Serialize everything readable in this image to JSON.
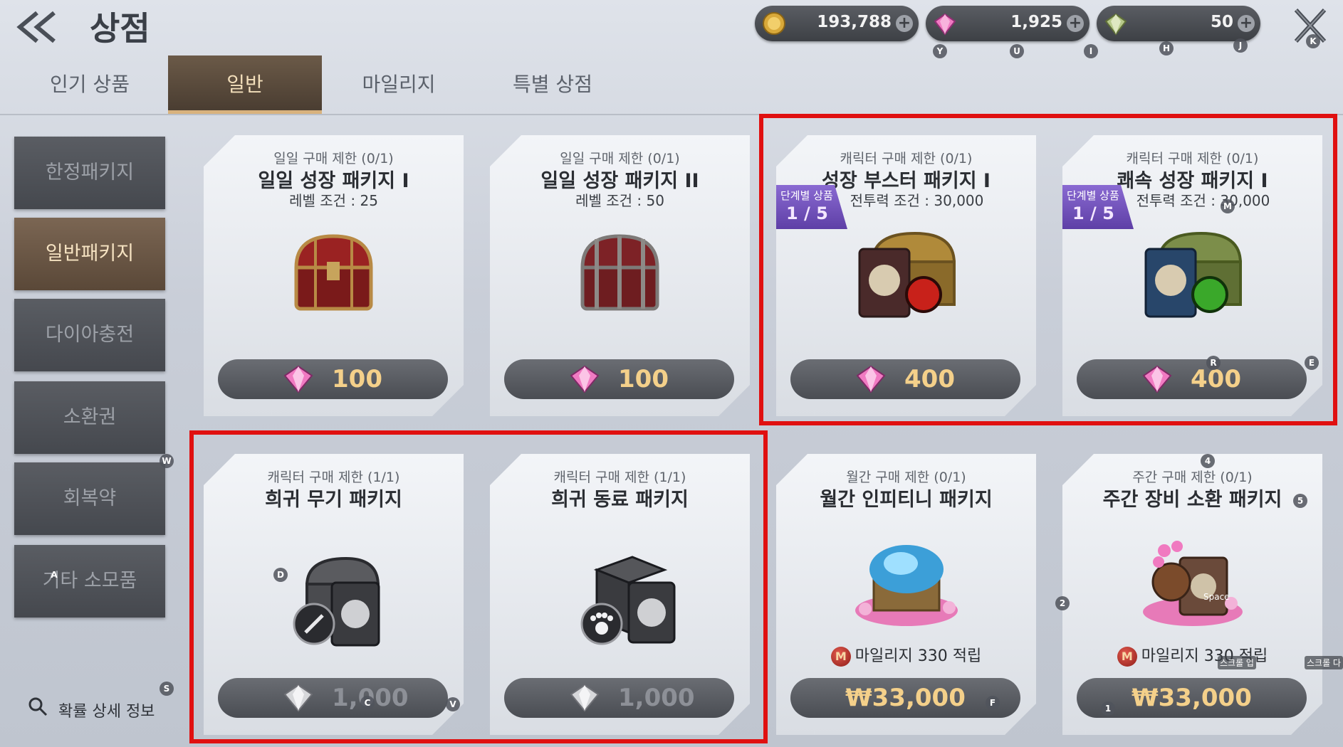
{
  "header": {
    "title": "상점",
    "currencies": [
      {
        "icon": "gold-coin-icon",
        "value": "193,788"
      },
      {
        "icon": "pink-diamond-icon",
        "value": "1,925"
      },
      {
        "icon": "green-diamond-icon",
        "value": "50"
      }
    ],
    "hotkeys": [
      "Y",
      "U",
      "I",
      "H",
      "J",
      "K"
    ]
  },
  "tabs": [
    {
      "label": "인기 상품",
      "active": false
    },
    {
      "label": "일반",
      "active": true
    },
    {
      "label": "마일리지",
      "active": false
    },
    {
      "label": "특별 상점",
      "active": false
    }
  ],
  "sidebar": {
    "items": [
      {
        "label": "한정패키지",
        "active": false
      },
      {
        "label": "일반패키지",
        "active": true
      },
      {
        "label": "다이아충전",
        "active": false
      },
      {
        "label": "소환권",
        "active": false
      },
      {
        "label": "회복약",
        "active": false
      },
      {
        "label": "기타 소모품",
        "active": false
      }
    ],
    "prob_info": "확률 상세 정보"
  },
  "cards": [
    {
      "limit": "일일 구매 제한 (0/1)",
      "name": "일일 성장 패키지 I",
      "cond": "레벨 조건 : 25",
      "art": "red-treasure-chest",
      "price": "100",
      "price_icon": "pink-diamond-icon"
    },
    {
      "limit": "일일 구매 제한 (0/1)",
      "name": "일일 성장 패키지 II",
      "cond": "레벨 조건 : 50",
      "art": "iron-treasure-chest",
      "price": "100",
      "price_icon": "pink-diamond-icon"
    },
    {
      "limit": "캐릭터 구매 제한 (0/1)",
      "name": "성장 부스터 패키지 I",
      "cond": "전투력 조건 : 30,000",
      "art": "gold-chest-with-cards",
      "price": "400",
      "price_icon": "pink-diamond-icon",
      "badge": {
        "l1": "단계별 상품",
        "l2": "1 / 5"
      }
    },
    {
      "limit": "캐릭터 구매 제한 (0/1)",
      "name": "쾌속 성장 패키지 I",
      "cond": "전투력 조건 : 30,000",
      "art": "green-chest-with-cards",
      "price": "400",
      "price_icon": "pink-diamond-icon",
      "badge": {
        "l1": "단계별 상품",
        "l2": "1 / 5"
      }
    },
    {
      "limit": "캐릭터 구매 제한 (1/1)",
      "name": "희귀 무기 패키지",
      "art": "weapon-chest-with-cards",
      "price": "1,000",
      "price_icon": "silver-diamond-icon",
      "dim": true
    },
    {
      "limit": "캐릭터 구매 제한 (1/1)",
      "name": "희귀 동료 패키지",
      "art": "companion-box-with-cards",
      "price": "1,000",
      "price_icon": "silver-diamond-icon",
      "dim": true
    },
    {
      "limit": "월간 구매 제한 (0/1)",
      "name": "월간 인피티니 패키지",
      "art": "crystal-chest-with-gems",
      "mileage": "마일리지 330 적립",
      "mileage_icon": "M",
      "price": "₩33,000"
    },
    {
      "limit": "주간 구매 제한 (0/1)",
      "name": "주간 장비 소환 패키지",
      "art": "gem-pile-with-cards",
      "mileage": "마일리지 330 적립",
      "mileage_icon": "M",
      "price": "₩33,000"
    }
  ],
  "overlay_hotkeys": [
    "W",
    "A",
    "S",
    "D",
    "M",
    "R",
    "E",
    "C",
    "V",
    "F",
    "4",
    "5",
    "2",
    "1",
    "Space"
  ],
  "overlay_labels": [
    "스크롤 업",
    "스크롤 다"
  ],
  "colors": {
    "highlight": "#e01010",
    "active_tab": "#4a3d31",
    "price_text": "#f4d08a",
    "badge": "#6e4fb8"
  }
}
